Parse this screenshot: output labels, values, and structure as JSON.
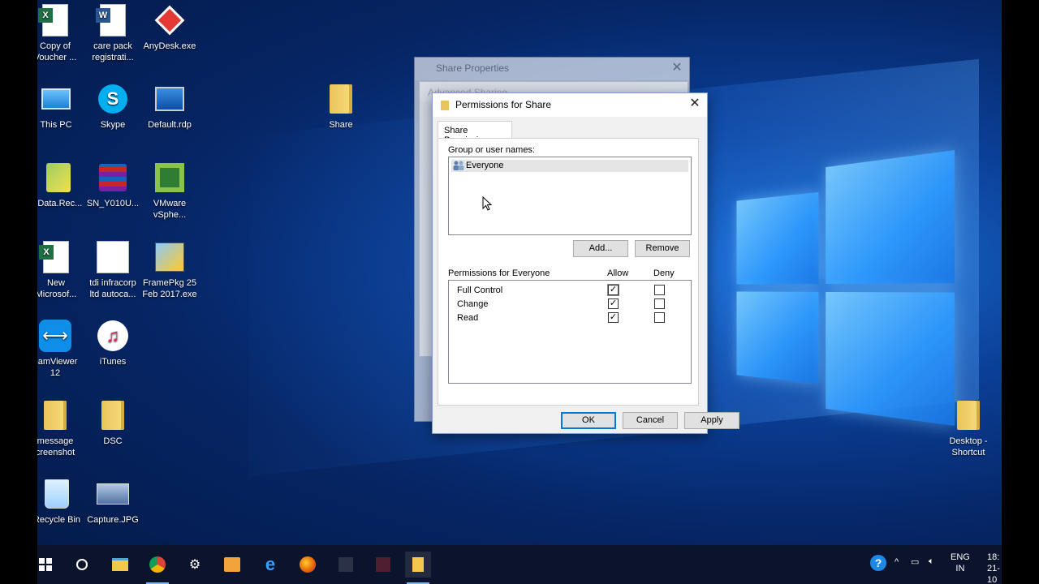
{
  "desktop": {
    "icons": [
      {
        "label": "Copy of\nVoucher ...",
        "icon": "excel-file-icon"
      },
      {
        "label": "care pack\nregistrati...",
        "icon": "word-file-icon"
      },
      {
        "label": "AnyDesk.exe",
        "icon": "anydesk-icon"
      },
      {
        "label": "This PC",
        "icon": "computer-icon"
      },
      {
        "label": "Skype",
        "icon": "skype-icon"
      },
      {
        "label": "Default.rdp",
        "icon": "remote-desktop-icon"
      },
      {
        "label": "Share",
        "icon": "folder-icon"
      },
      {
        "label": "-Data.Rec...",
        "icon": "data-recovery-icon"
      },
      {
        "label": "SN_Y010U...",
        "icon": "winrar-archive-icon"
      },
      {
        "label": "VMware\nvSphe...",
        "icon": "vmware-icon"
      },
      {
        "label": "New\nMicrosof...",
        "icon": "excel-file-icon"
      },
      {
        "label": "tdi infracorp\nltd autoca...",
        "icon": "document-icon"
      },
      {
        "label": "FramePkg 25\nFeb 2017.exe",
        "icon": "installer-icon"
      },
      {
        "label": "eamViewer\n12",
        "icon": "teamviewer-icon"
      },
      {
        "label": "iTunes",
        "icon": "itunes-icon"
      },
      {
        "label": "message\ncreenshot",
        "icon": "folder-icon"
      },
      {
        "label": "DSC",
        "icon": "folder-icon"
      },
      {
        "label": "Recycle Bin",
        "icon": "recycle-bin-icon"
      },
      {
        "label": "Capture.JPG",
        "icon": "image-file-icon"
      },
      {
        "label": "Desktop -\nShortcut",
        "icon": "folder-shortcut-icon"
      }
    ]
  },
  "background_windows": {
    "share_properties_title": "Share Properties",
    "advanced_sharing_title": "Advanced Sharing"
  },
  "dialog": {
    "title": "Permissions for Share",
    "tab_label": "Share Permissions",
    "group_label": "Group or user names:",
    "users": [
      "Everyone"
    ],
    "add_button": "Add...",
    "remove_button": "Remove",
    "permissions_label": "Permissions for Everyone",
    "allow_header": "Allow",
    "deny_header": "Deny",
    "permissions": [
      {
        "name": "Full Control",
        "allow": true,
        "deny": false
      },
      {
        "name": "Change",
        "allow": true,
        "deny": false
      },
      {
        "name": "Read",
        "allow": true,
        "deny": false
      }
    ],
    "ok_button": "OK",
    "cancel_button": "Cancel",
    "apply_button": "Apply"
  },
  "taskbar": {
    "tray_lang_top": "ENG",
    "tray_lang_bottom": "IN",
    "clock_time": "18:",
    "clock_date": "21-10"
  },
  "colors": {
    "accent": "#0078d7",
    "taskbar": "#0c1428",
    "desktop_bg": "#062564"
  }
}
